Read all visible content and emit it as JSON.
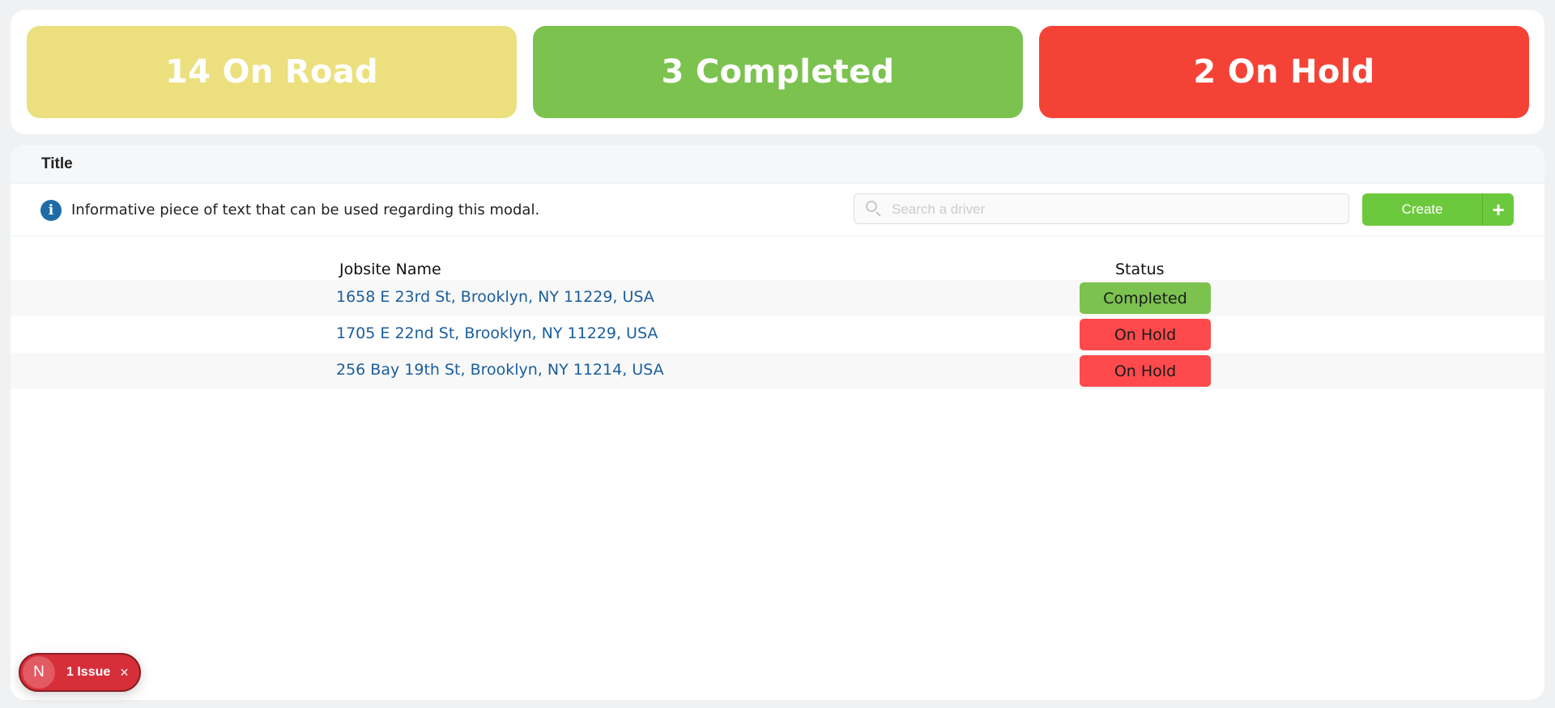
{
  "summary": {
    "cards": [
      {
        "label": "14 On Road",
        "color": "#ece07e"
      },
      {
        "label": "3 Completed",
        "color": "#7bc24f"
      },
      {
        "label": "2 On Hold",
        "color": "#f44336"
      }
    ]
  },
  "panel": {
    "title": "Title",
    "info_text": "Informative piece of text that can be used regarding this modal.",
    "info_icon": "info-circle-icon"
  },
  "search": {
    "placeholder": "Search a driver",
    "value": ""
  },
  "toolbar": {
    "create_label": "Create",
    "plus_label": "+"
  },
  "table": {
    "columns": [
      "Jobsite Name",
      "Status"
    ],
    "rows": [
      {
        "name": "1658 E 23rd St, Brooklyn, NY 11229, USA",
        "status": "Completed",
        "status_color": "#7bc24f"
      },
      {
        "name": "1705 E 22nd St, Brooklyn, NY 11229, USA",
        "status": "On Hold",
        "status_color": "#ff4a4d"
      },
      {
        "name": "256 Bay 19th St, Brooklyn, NY 11214, USA",
        "status": "On Hold",
        "status_color": "#ff4a4d"
      }
    ]
  },
  "issues": {
    "avatar_letter": "N",
    "label": "1 Issue",
    "close_label": "×"
  }
}
